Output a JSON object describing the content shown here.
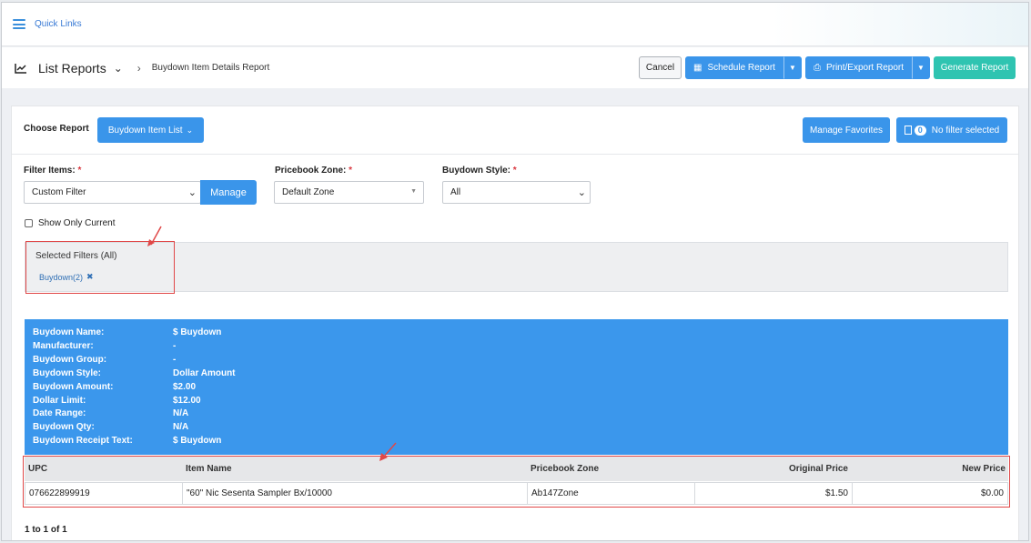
{
  "quicklinks": {
    "label": "Quick Links"
  },
  "header": {
    "title": "List Reports",
    "breadcrumb": "Buydown Item Details Report",
    "cancel_label": "Cancel",
    "schedule_label": "Schedule Report",
    "print_label": "Print/Export Report",
    "generate_label": "Generate Report"
  },
  "controls": {
    "choose_label": "Choose Report",
    "report_select": "Buydown Item List",
    "manage_favorites": "Manage Favorites",
    "filter_count": "0",
    "no_filter_label": "No filter selected"
  },
  "filters": {
    "filter_items_label": "Filter Items:",
    "filter_items_value": "Custom Filter",
    "manage_label": "Manage",
    "pricebook_zone_label": "Pricebook Zone:",
    "pricebook_zone_value": "Default Zone",
    "buydown_style_label": "Buydown Style:",
    "buydown_style_value": "All",
    "required_mark": "*",
    "show_only_current": "Show Only Current"
  },
  "selected_filters": {
    "title": "Selected Filters (All)",
    "chip": "Buydown(2)"
  },
  "buydown_info": [
    {
      "label": "Buydown Name:",
      "value": "$ Buydown"
    },
    {
      "label": "Manufacturer:",
      "value": "-"
    },
    {
      "label": "Buydown Group:",
      "value": "-"
    },
    {
      "label": "Buydown Style:",
      "value": "Dollar Amount"
    },
    {
      "label": "Buydown Amount:",
      "value": "$2.00"
    },
    {
      "label": "Dollar Limit:",
      "value": "$12.00"
    },
    {
      "label": "Date Range:",
      "value": "N/A"
    },
    {
      "label": "Buydown Qty:",
      "value": "N/A"
    },
    {
      "label": "Buydown Receipt Text:",
      "value": "$ Buydown"
    }
  ],
  "table": {
    "columns": [
      "UPC",
      "Item Name",
      "Pricebook Zone",
      "Original Price",
      "New Price"
    ],
    "rows": [
      [
        "076622899919",
        "\"60\" Nic Sesenta Sampler Bx/10000",
        "Ab147Zone",
        "$1.50",
        "$0.00"
      ]
    ]
  },
  "pager": {
    "text": "1 to 1 of 1"
  },
  "colors": {
    "primary": "#3a95ea",
    "teal": "#2fc4b1",
    "highlight": "#e04848"
  }
}
